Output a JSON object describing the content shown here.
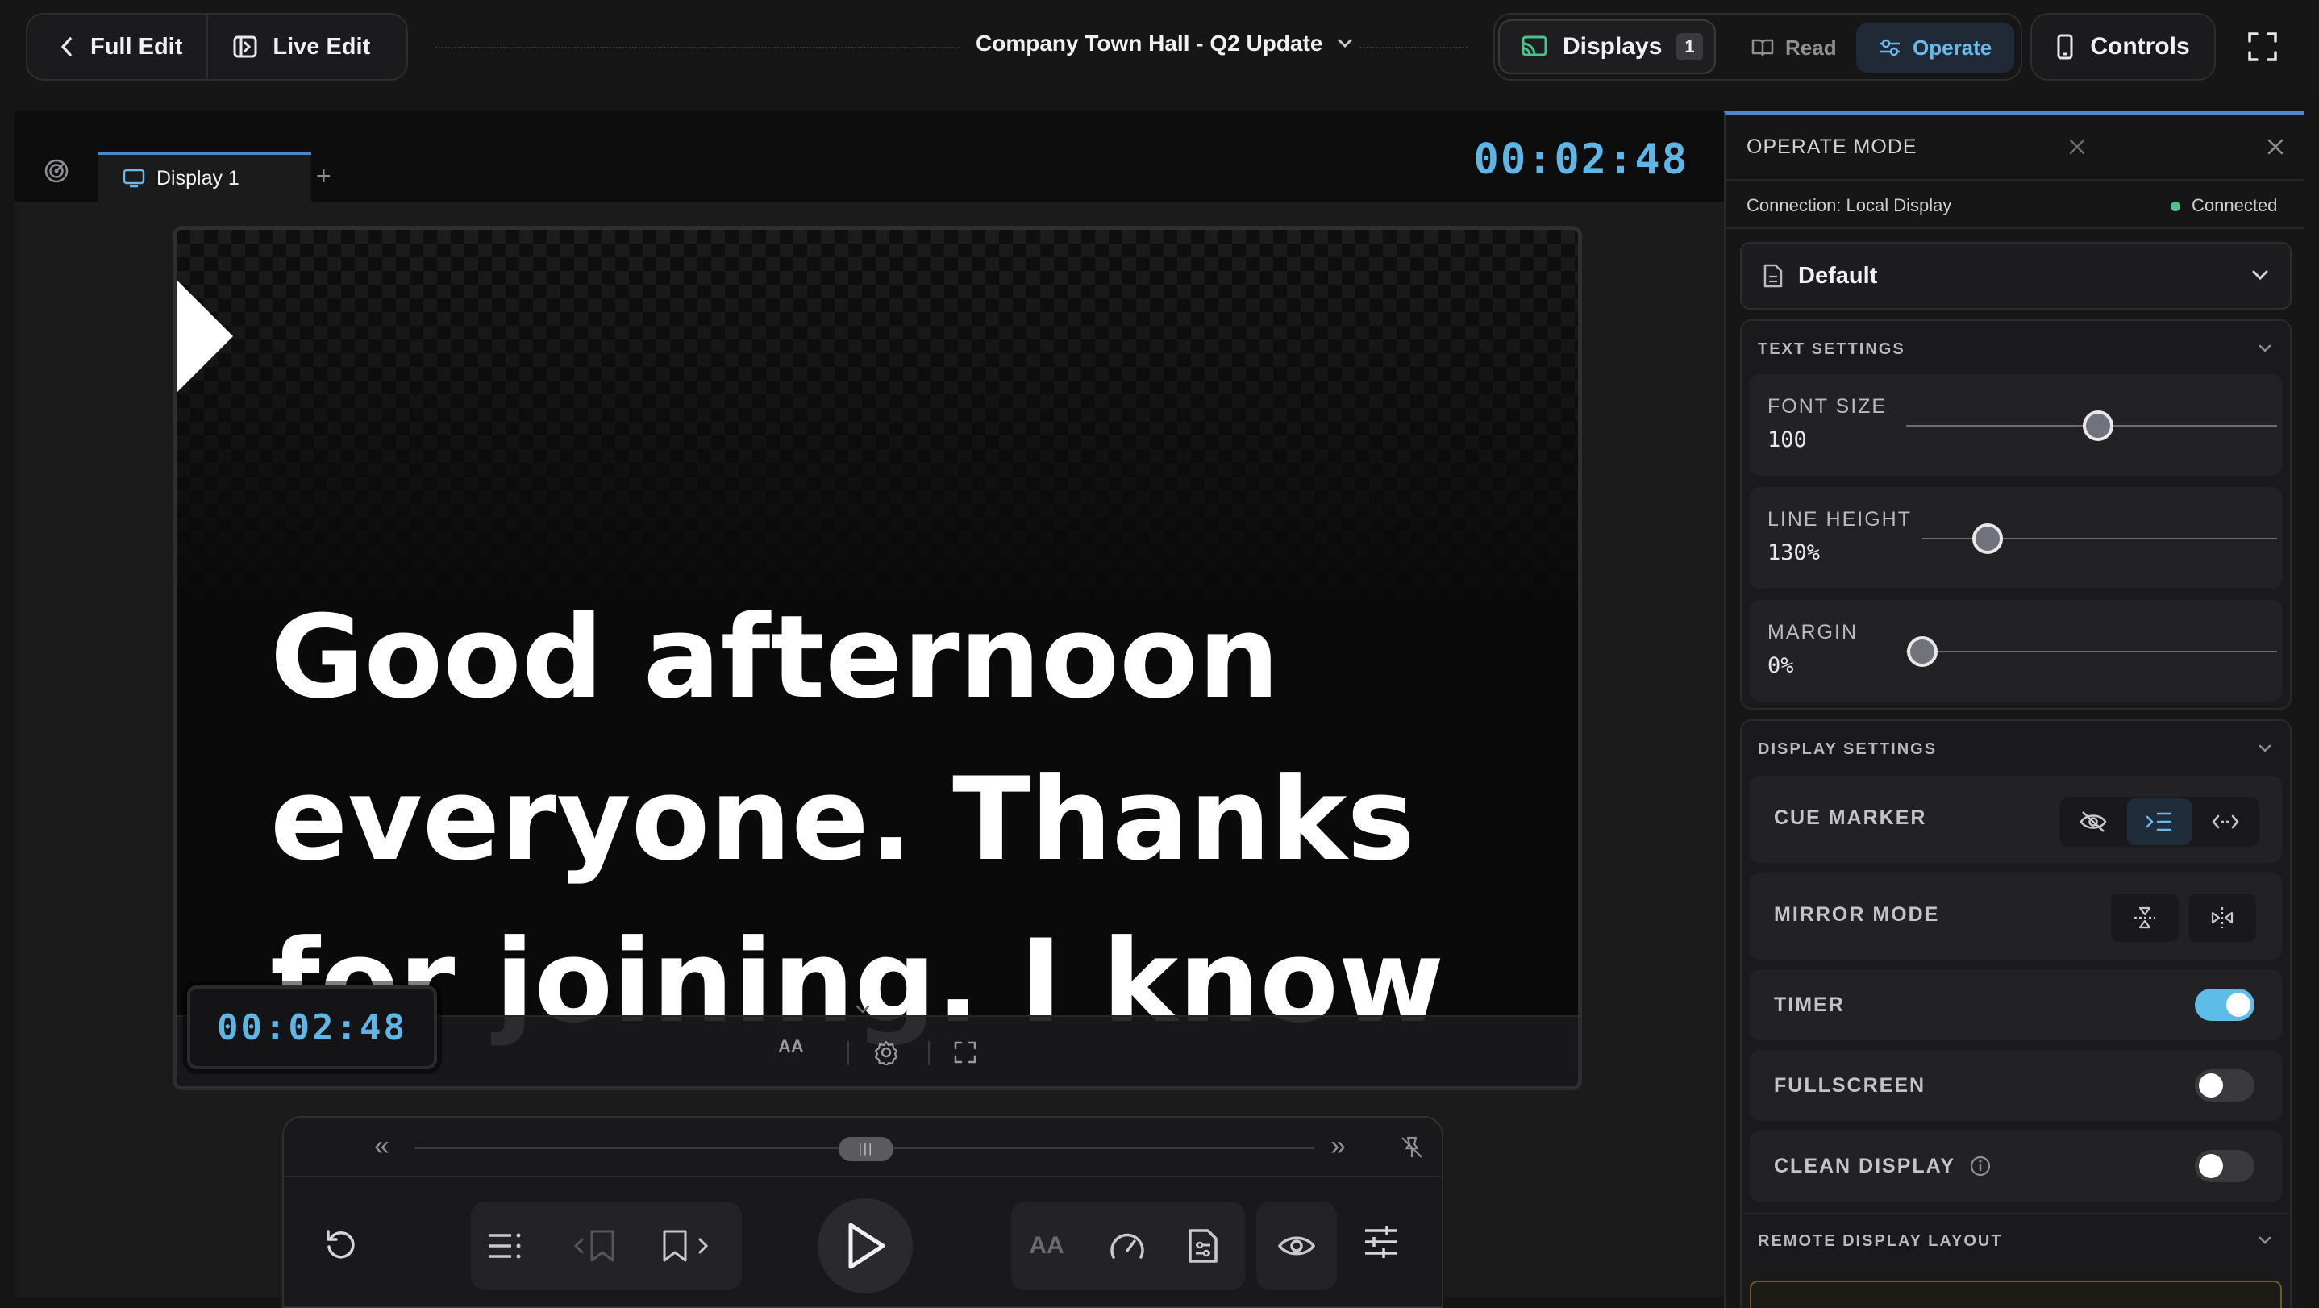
{
  "topbar": {
    "full_edit_label": "Full Edit",
    "live_edit_label": "Live Edit",
    "document_title": "Company Town Hall - Q2 Update",
    "displays_label": "Displays",
    "displays_count": "1",
    "read_label": "Read",
    "operate_label": "Operate",
    "controls_label": "Controls"
  },
  "stage": {
    "tab_label": "Display 1",
    "add_tab": "+",
    "main_timer": "00:02:48",
    "overlay_timer": "00:02:48",
    "script_text": "Good afternoon everyone. Thanks for joining. I know it's a",
    "screen_toolbar": {
      "text_size_label": "AA"
    }
  },
  "controls": {
    "skip_back": "«",
    "skip_forward": "»",
    "text_size_label": "AA",
    "scrub_position": 0.5
  },
  "panel": {
    "title": "OPERATE MODE",
    "connection_label": "Connection: Local Display",
    "connection_status": "Connected",
    "preset": "Default",
    "text_settings": {
      "heading": "TEXT SETTINGS",
      "font_size": {
        "label": "FONT SIZE",
        "value": "100",
        "position": 0.52
      },
      "line_height": {
        "label": "LINE HEIGHT",
        "value": "130%",
        "position": 0.18
      },
      "margin": {
        "label": "MARGIN",
        "value": "0%",
        "position": 0.0
      }
    },
    "display_settings": {
      "heading": "DISPLAY SETTINGS",
      "cue_marker": "CUE MARKER",
      "mirror_mode": "MIRROR MODE",
      "timer": {
        "label": "TIMER",
        "on": true
      },
      "fullscreen": {
        "label": "FULLSCREEN",
        "on": false
      },
      "clean_display": {
        "label": "CLEAN DISPLAY",
        "on": false
      }
    },
    "remote_layout_heading": "REMOTE DISPLAY LAYOUT"
  },
  "colors": {
    "accent": "#5eb6e6",
    "tab_accent": "#4f86c9",
    "connected": "#4cc38a",
    "toggle_on": "#5ebce8"
  },
  "icons": [
    "chevron-left-icon",
    "live-edit-icon",
    "chevron-down-icon",
    "cast-icon",
    "book-icon",
    "sliders-icon",
    "phone-icon",
    "fullscreen-icon",
    "radar-icon",
    "monitor-icon",
    "gear-icon",
    "expand-icon",
    "pin-off-icon",
    "reset-icon",
    "list-icon",
    "bookmark-prev-icon",
    "bookmark-next-icon",
    "play-icon",
    "speedometer-icon",
    "document-settings-icon",
    "eye-icon",
    "tune-icon",
    "close-icon",
    "file-icon",
    "eye-off-icon",
    "indent-icon",
    "code-arrows-icon",
    "flip-vertical-icon",
    "flip-horizontal-icon",
    "info-icon"
  ]
}
